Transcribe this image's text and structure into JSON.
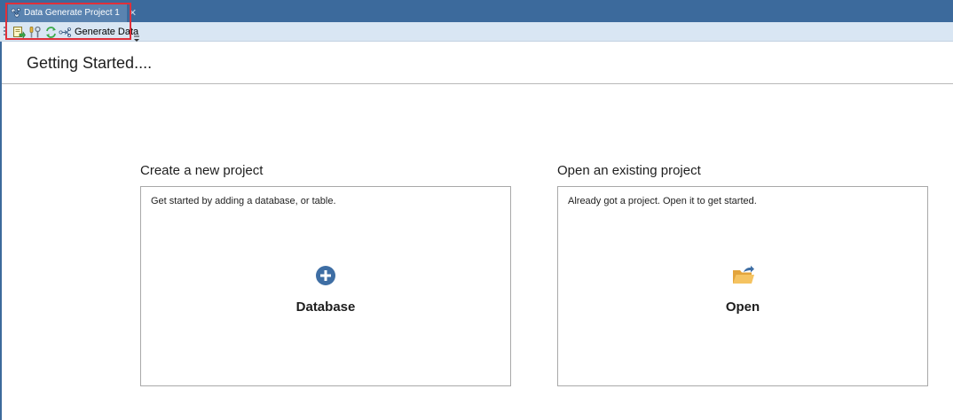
{
  "tab": {
    "title": "Data Generate Project 1",
    "close_glyph": "✕",
    "icon": "data-generator-icon"
  },
  "toolbar": {
    "buttons": [
      {
        "icon": "new-project-icon"
      },
      {
        "icon": "tools-icon"
      },
      {
        "icon": "refresh-icon"
      }
    ],
    "generate_label": "Generate Data",
    "generate_icon": "generate-data-icon",
    "more_icon": "overflow-chevron-icon"
  },
  "page": {
    "title": "Getting Started...."
  },
  "new_project": {
    "heading": "Create a new project",
    "description": "Get started by adding a database, or table.",
    "action_label": "Database",
    "icon": "add-circle-icon",
    "icon_color": "#3e6ea4"
  },
  "open_project": {
    "heading": "Open an existing project",
    "description": "Already got a project. Open it to get started.",
    "action_label": "Open",
    "icon": "open-folder-icon",
    "icon_color": "#f0b54a"
  },
  "colors": {
    "title_bar": "#3c6a9c",
    "toolbar": "#d9e6f3",
    "highlight_border": "#e0303a"
  }
}
